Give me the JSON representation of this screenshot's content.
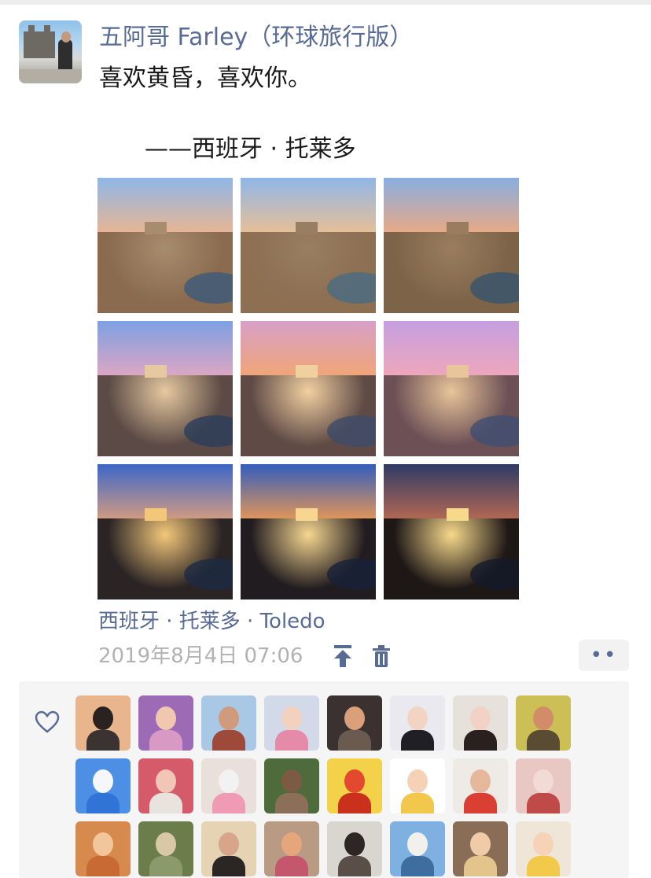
{
  "post": {
    "author": "五阿哥 Farley（环球旅行版）",
    "text_line1": "喜欢黄昏，喜欢你。",
    "text_line2": "——西班牙 · 托莱多",
    "location": "西班牙 · 托莱多 · Toledo",
    "timestamp": "2019年8月4日 07:06",
    "more_label": "••"
  },
  "icons": {
    "avatar": "avatar-photo",
    "pin_top": "pin-to-top-icon",
    "delete": "trash-icon",
    "like": "heart-icon"
  },
  "photos": [
    {
      "sky": "#8fb7e8",
      "sky2": "#f0b58a",
      "land": "#8a6b4f",
      "castle": "#a78c6d",
      "river": "#3b5a7a"
    },
    {
      "sky": "#8fb7e8",
      "sky2": "#f0c08e",
      "land": "#8d6f52",
      "castle": "#987e62",
      "river": "#4a6b83"
    },
    {
      "sky": "#88aee1",
      "sky2": "#f2a97c",
      "land": "#7d6449",
      "castle": "#9a7d5e",
      "river": "#36546f"
    },
    {
      "sky": "#7ea0e3",
      "sky2": "#e6a7c0",
      "land": "#5b4a45",
      "castle": "#e6c9a0",
      "river": "#2b3d5a"
    },
    {
      "sky": "#d7a0c8",
      "sky2": "#f3a66f",
      "land": "#5f4a46",
      "castle": "#f1d0a0",
      "river": "#3d4b69"
    },
    {
      "sky": "#c59fe0",
      "sky2": "#f2a7b8",
      "land": "#6c5055",
      "castle": "#e8c59a",
      "river": "#3f4f73"
    },
    {
      "sky": "#3b67c9",
      "sky2": "#e0a07c",
      "land": "#2b2425",
      "castle": "#f3c77a",
      "river": "#1d2a44"
    },
    {
      "sky": "#325dbd",
      "sky2": "#f29b4f",
      "land": "#211c1f",
      "castle": "#f6d690",
      "river": "#182238"
    },
    {
      "sky": "#2e3b65",
      "sky2": "#c06c52",
      "land": "#1d1716",
      "castle": "#f7d98c",
      "river": "#141a2a"
    }
  ],
  "likers": [
    {
      "bg": "#e9b58d",
      "face": "#2a2220",
      "body": "#3a3331"
    },
    {
      "bg": "#9d6bb5",
      "face": "#f1c7b0",
      "body": "#d89ac4"
    },
    {
      "bg": "#a9c8e6",
      "face": "#d09b7d",
      "body": "#9e4a3a"
    },
    {
      "bg": "#d2d9e8",
      "face": "#f2d2bf",
      "body": "#e58aa8"
    },
    {
      "bg": "#3b3130",
      "face": "#d9a07a",
      "body": "#6a5a4f"
    },
    {
      "bg": "#e9e9ef",
      "face": "#f3d4c4",
      "body": "#1f1f25"
    },
    {
      "bg": "#e7e1dc",
      "face": "#f2d2c4",
      "body": "#2a2020"
    },
    {
      "bg": "#cbbf56",
      "face": "#d28c6a",
      "body": "#5a4c33"
    },
    {
      "bg": "#4c8fe5",
      "face": "#f5f7fb",
      "body": "#2f74d6"
    },
    {
      "bg": "#d55b6a",
      "face": "#f1c6b6",
      "body": "#e9e3de"
    },
    {
      "bg": "#e9dfdb",
      "face": "#f2f2f2",
      "body": "#ef9bb5"
    },
    {
      "bg": "#4e6b3b",
      "face": "#7d5a44",
      "body": "#8b6f59"
    },
    {
      "bg": "#f3d24a",
      "face": "#e2492f",
      "body": "#c9311d"
    },
    {
      "bg": "#ffffff",
      "face": "#f5d1b6",
      "body": "#f2c84c"
    },
    {
      "bg": "#eeeae6",
      "face": "#e5b79b",
      "body": "#d93f33"
    },
    {
      "bg": "#e9c7c2",
      "face": "#f2dbd6",
      "body": "#c04a47"
    },
    {
      "bg": "#d78a4e",
      "face": "#f2c69a",
      "body": "#c86a33"
    },
    {
      "bg": "#6a7d4a",
      "face": "#d9c8a6",
      "body": "#8a9a6a"
    },
    {
      "bg": "#e6d3b4",
      "face": "#d7a68a",
      "body": "#2a2626"
    },
    {
      "bg": "#b99b83",
      "face": "#e7a57c",
      "body": "#c4576b"
    },
    {
      "bg": "#d9d5cf",
      "face": "#2d2624",
      "body": "#5a4e48"
    },
    {
      "bg": "#7fb0e2",
      "face": "#f2f0ea",
      "body": "#3d6e9f"
    },
    {
      "bg": "#8a6d56",
      "face": "#f0cba8",
      "body": "#e3c48a"
    },
    {
      "bg": "#efe6d8",
      "face": "#f6d2b6",
      "body": "#f2c94a"
    }
  ]
}
